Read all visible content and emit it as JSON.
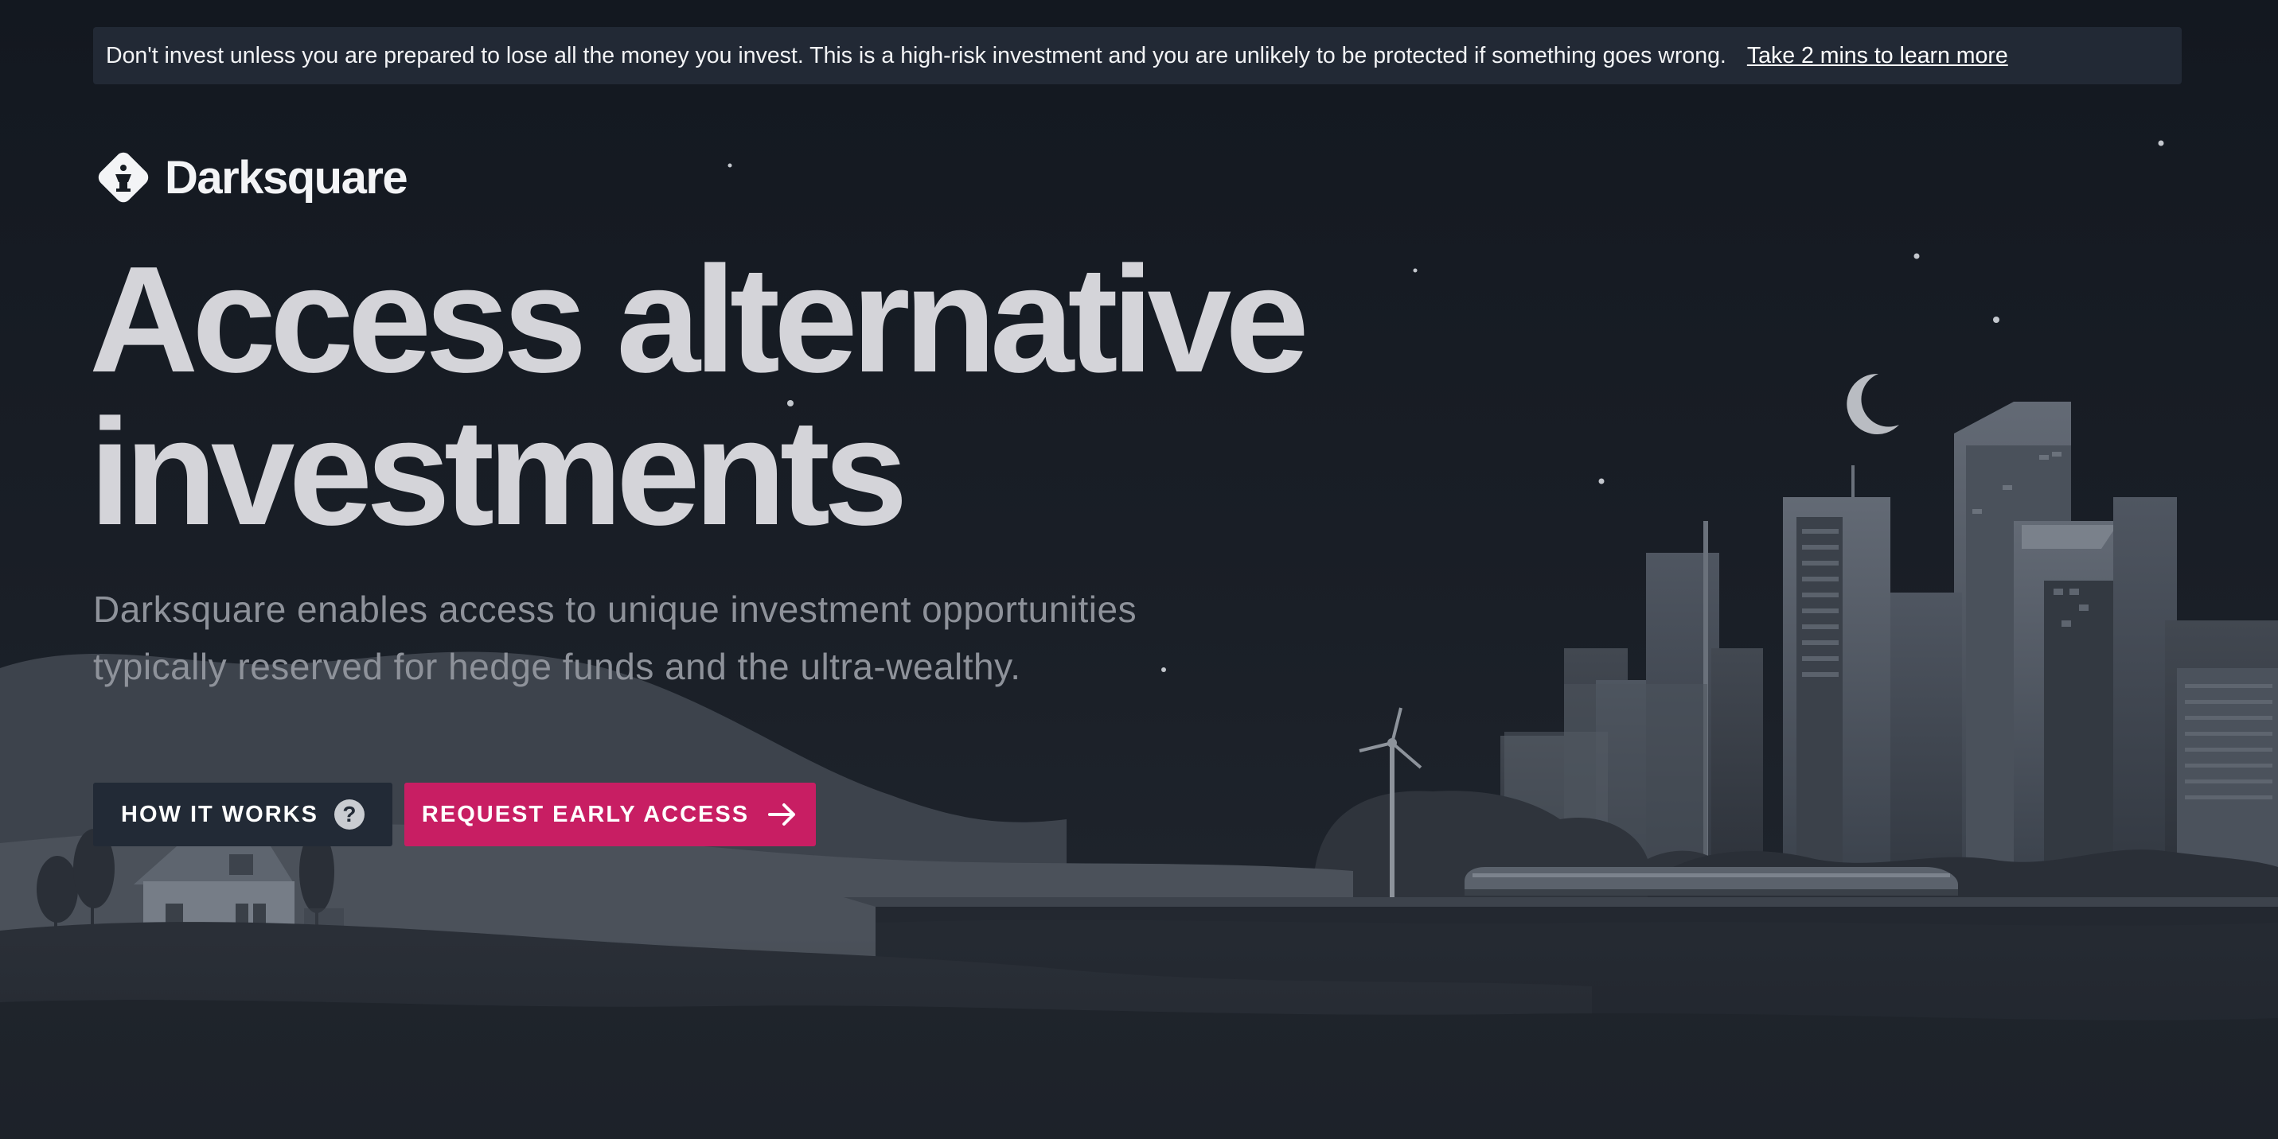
{
  "banner": {
    "warning_text": "Don't invest unless you are prepared to lose all the money you invest. This is a high-risk investment and you are unlikely to be protected if something goes wrong.",
    "link_text": "Take 2 mins to learn more"
  },
  "brand": {
    "name": "Darksquare",
    "logo_icon": "chess-queen-diamond-icon"
  },
  "hero": {
    "headline_line1": "Access alternative",
    "headline_line2": "investments",
    "subheading": "Darksquare enables access to unique investment opportunities typically reserved for hedge funds and the ultra-wealthy."
  },
  "actions": {
    "how_it_works_label": "HOW IT WORKS",
    "how_it_works_icon": "question-mark-icon",
    "request_access_label": "REQUEST EARLY ACCESS",
    "request_access_icon": "arrow-right-icon"
  },
  "colors": {
    "background": "#161b22",
    "banner_bg": "#222935",
    "accent": "#c81e63",
    "headline": "#d4d4d9",
    "subheading": "#8e929a"
  },
  "illustration": {
    "description_icons": [
      "moon-icon",
      "star-icon",
      "city-skyline-illustration",
      "wind-turbine-icon",
      "train-icon",
      "house-icon",
      "tree-icon"
    ]
  }
}
